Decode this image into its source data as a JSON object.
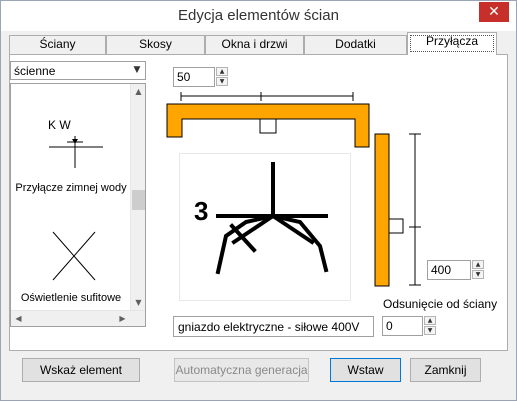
{
  "window": {
    "title": "Edycja elementów ścian",
    "close_glyph": "✕"
  },
  "tabs": [
    {
      "label": "Ściany"
    },
    {
      "label": "Skosy"
    },
    {
      "label": "Okna i drzwi"
    },
    {
      "label": "Dodatki"
    },
    {
      "label": "Przyłącza"
    }
  ],
  "active_tab": "Przyłącza",
  "category": {
    "selected": "ścienne"
  },
  "list": {
    "items": [
      {
        "label": "Przyłącze zimnej wody",
        "icon_text": "K W"
      },
      {
        "label": "Oświetlenie sufitowe"
      }
    ]
  },
  "width_value": "50",
  "height_value": "400",
  "offset_label": "Odsunięcie od ściany",
  "offset_value": "0",
  "element_name": "gniazdo elektryczne - siłowe 400V",
  "preview": {
    "symbol_text": "3"
  },
  "buttons": {
    "show_element": "Wskaż element",
    "auto_generate": "Automatyczna generacja",
    "insert": "Wstaw",
    "close": "Zamknij"
  },
  "colors": {
    "wall": "#ffa500",
    "close_button": "#c7302a",
    "focus": "#0078d7"
  }
}
